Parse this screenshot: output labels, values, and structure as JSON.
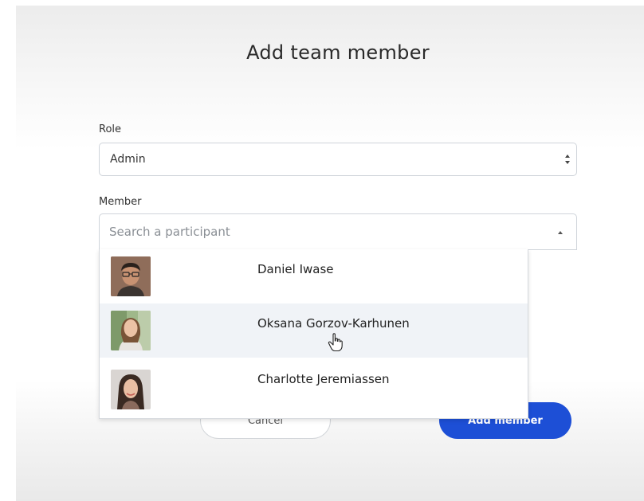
{
  "dialog": {
    "title": "Add team member"
  },
  "role": {
    "label": "Role",
    "value": "Admin"
  },
  "member": {
    "label": "Member",
    "placeholder": "Search a participant"
  },
  "dropdown": {
    "options": [
      {
        "name": "Daniel Iwase",
        "avatar": "avatar-photo-man"
      },
      {
        "name": "Oksana Gorzov-Karhunen",
        "avatar": "avatar-photo-woman"
      },
      {
        "name": "Charlotte Jeremiassen",
        "avatar": "avatar-photo-woman"
      }
    ],
    "hovered_index": 1
  },
  "footer": {
    "cancel_label": "Cancel",
    "add_label": "Add member"
  },
  "colors": {
    "primary_button": "#1d4fd6",
    "hover_row": "#f0f3f7"
  },
  "icons": [
    "select-arrows-icon",
    "caret-up-icon",
    "hand-pointer-cursor-icon"
  ]
}
